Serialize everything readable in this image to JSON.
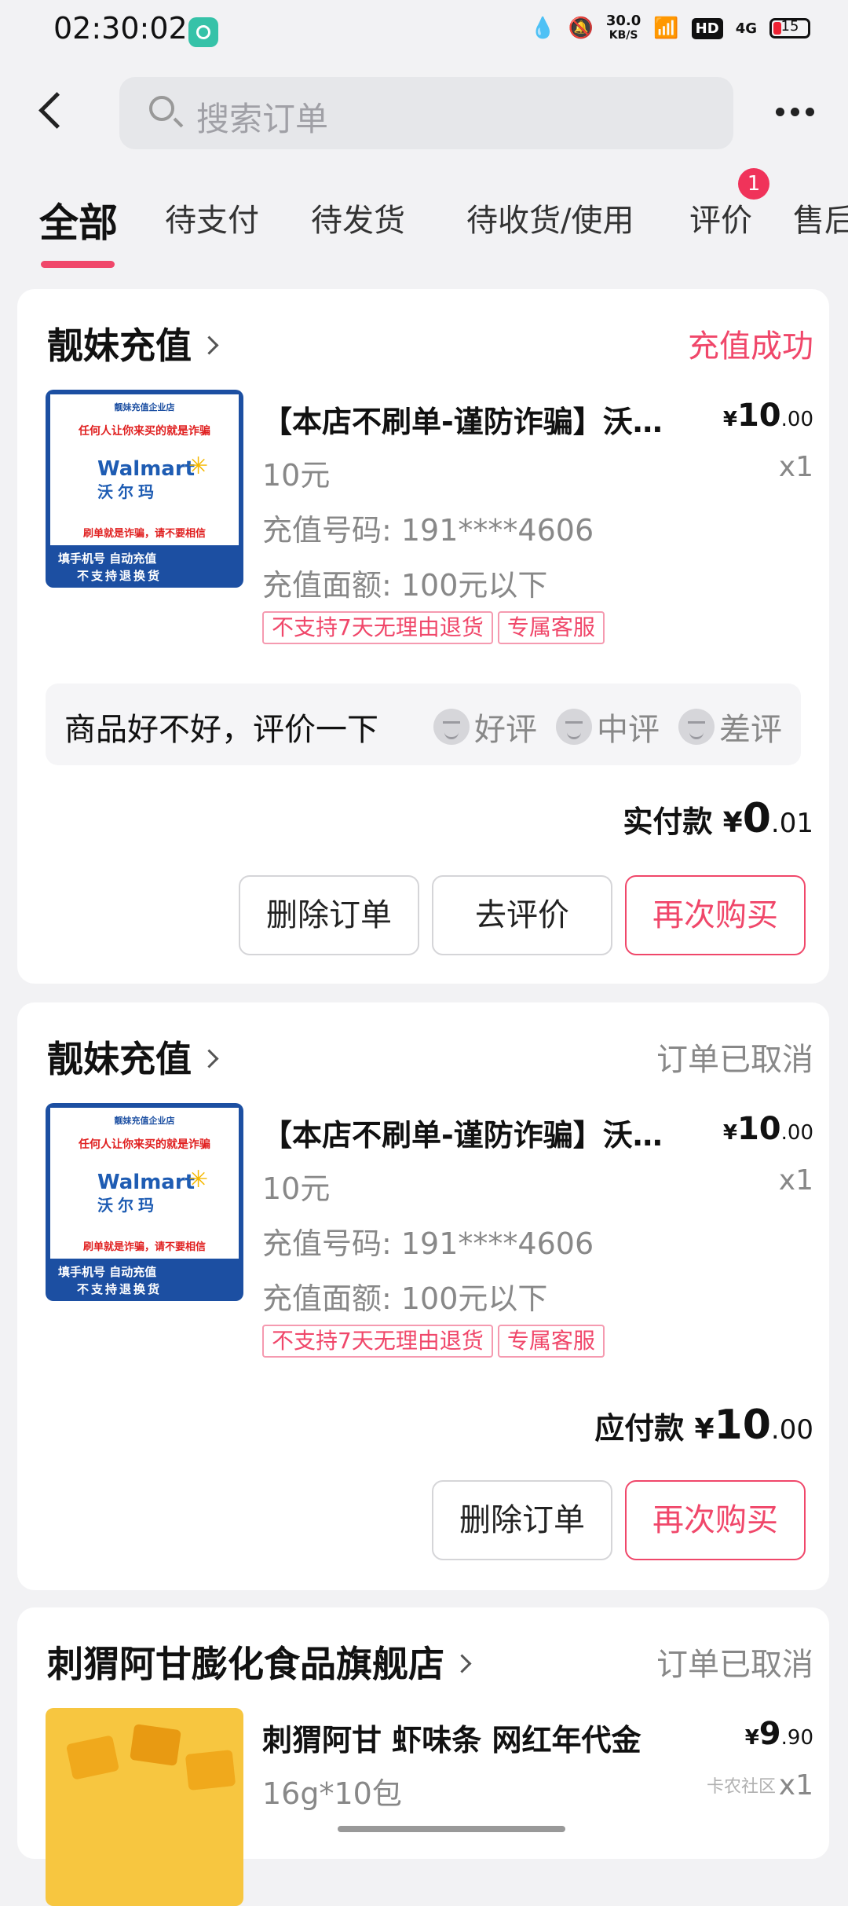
{
  "status_bar": {
    "time": "02:30:02",
    "speed_top": "30.0",
    "speed_unit": "KB/S",
    "hd": "HD",
    "network": "4G",
    "battery": "15"
  },
  "header": {
    "search_placeholder": "搜索订单"
  },
  "tabs": [
    {
      "label": "全部",
      "active": true
    },
    {
      "label": "待支付"
    },
    {
      "label": "待发货"
    },
    {
      "label": "待收货/使用"
    },
    {
      "label": "评价",
      "badge": "1"
    },
    {
      "label": "售后"
    }
  ],
  "orders": [
    {
      "shop": "靓妹充值",
      "status": "充值成功",
      "status_color": "#f0476a",
      "product_title": "【本店不刷单-谨防诈骗】沃尔玛",
      "price_yen": "¥",
      "price_int": "10",
      "price_dec": ".00",
      "qty": "x1",
      "spec1": "10元",
      "spec2": "充值号码: 191****4606",
      "spec3": "充值面额: 100元以下",
      "tags": [
        "不支持7天无理由退货",
        "专属客服"
      ],
      "rate_prompt": "商品好不好，评价一下",
      "rate_options": [
        "好评",
        "中评",
        "差评"
      ],
      "total_label": "实付款",
      "total_yen": "¥",
      "total_int": "0",
      "total_dec": ".01",
      "buttons": [
        "删除订单",
        "去评价",
        "再次购买"
      ],
      "thumb": {
        "t1": "靓妹充值企业店",
        "t2": "任何人让你来买的就是诈骗",
        "brand": "Walmart",
        "brand_cn": "沃尔玛",
        "t5": "刷单就是诈骗，请不要相信",
        "t6": "填手机号 自动充值",
        "t7": "不支持退换货"
      }
    },
    {
      "shop": "靓妹充值",
      "status": "订单已取消",
      "product_title": "【本店不刷单-谨防诈骗】沃尔玛",
      "price_yen": "¥",
      "price_int": "10",
      "price_dec": ".00",
      "qty": "x1",
      "spec1": "10元",
      "spec2": "充值号码: 191****4606",
      "spec3": "充值面额: 100元以下",
      "tags": [
        "不支持7天无理由退货",
        "专属客服"
      ],
      "total_label": "应付款",
      "total_yen": "¥",
      "total_int": "10",
      "total_dec": ".00",
      "buttons": [
        "删除订单",
        "再次购买"
      ],
      "thumb": {
        "t1": "靓妹充值企业店",
        "t2": "任何人让你来买的就是诈骗",
        "brand": "Walmart",
        "brand_cn": "沃尔玛",
        "t5": "刷单就是诈骗，请不要相信",
        "t6": "填手机号 自动充值",
        "t7": "不支持退换货"
      }
    },
    {
      "shop": "刺猬阿甘膨化食品旗舰店",
      "status": "订单已取消",
      "product_title": "刺猬阿甘 虾味条 网红年代金",
      "price_yen": "¥",
      "price_int": "9",
      "price_dec": ".90",
      "qty": "x1",
      "spec1": "16g*10包"
    }
  ],
  "watermark": "卡农社区"
}
